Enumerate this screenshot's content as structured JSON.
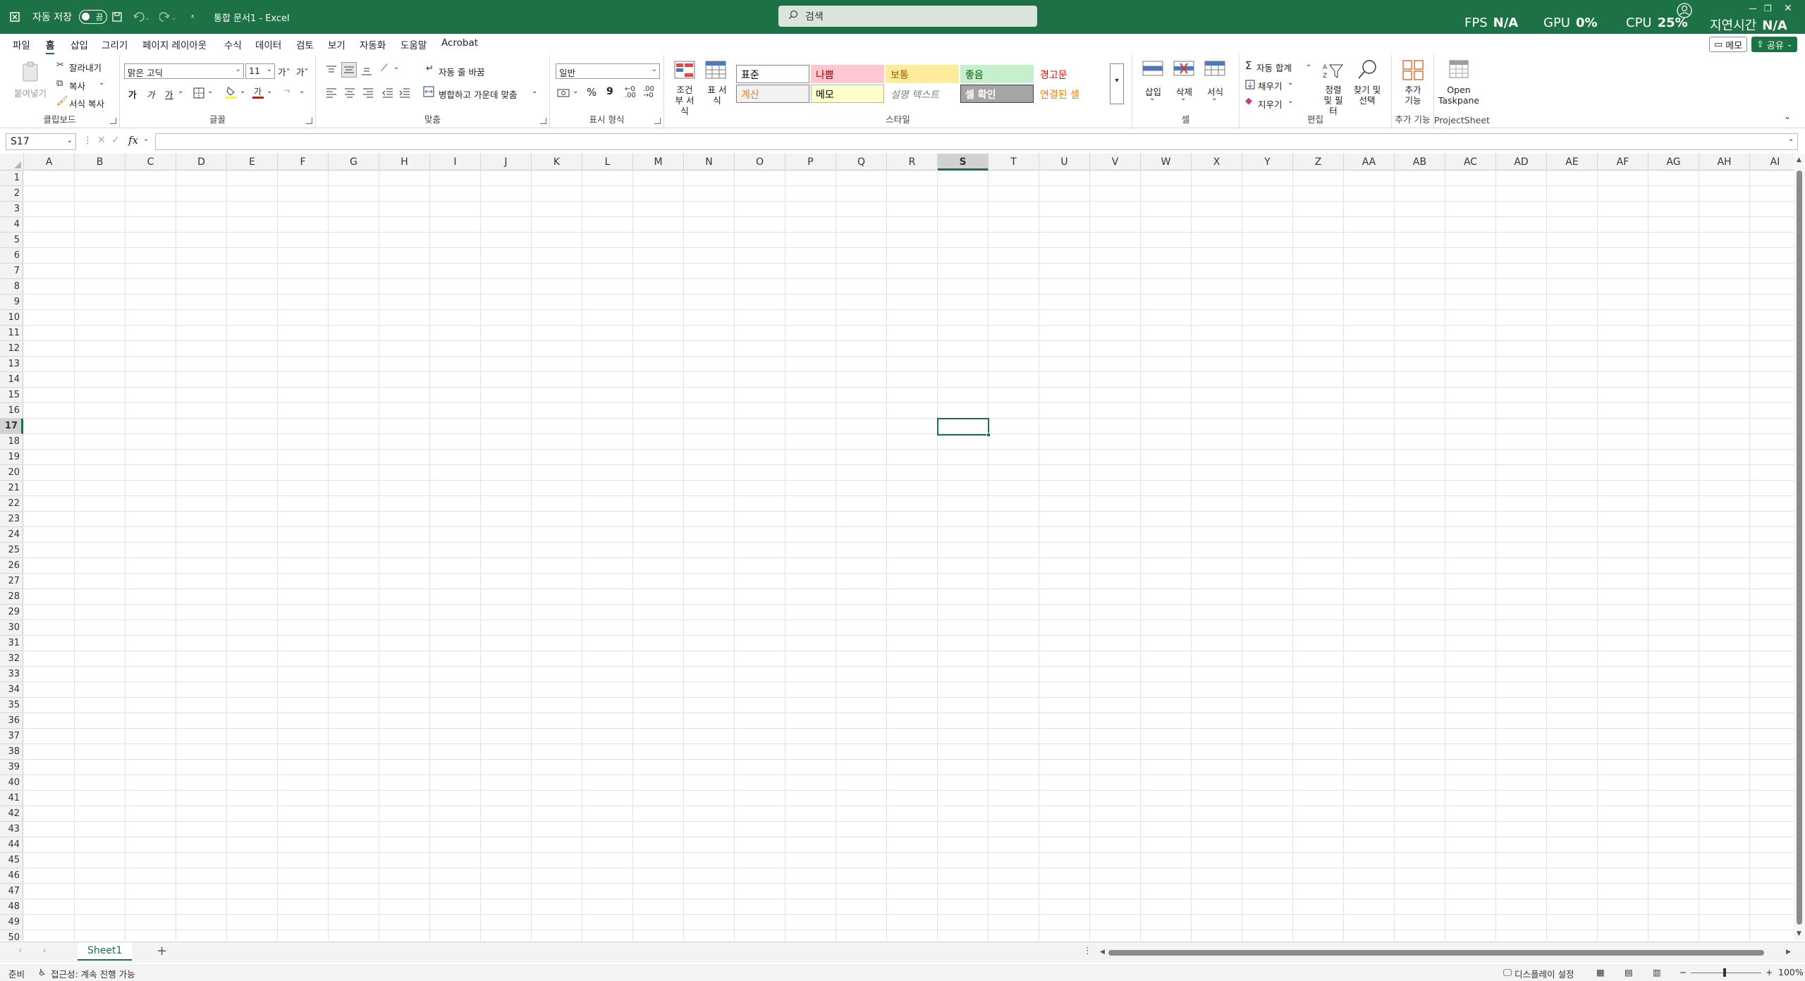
{
  "titlebar": {
    "autosave_label": "자동 저장",
    "autosave_state": "끔",
    "doc_title": "통합 문서1  -  Excel",
    "search_placeholder": "검색",
    "fps_label": "FPS",
    "fps_value": "N/A",
    "gpu_label": "GPU",
    "gpu_value": "0%",
    "cpu_label": "CPU",
    "cpu_value": "25%",
    "latency_label": "지연시간",
    "latency_value": "N/A"
  },
  "menu": {
    "tabs": [
      "파일",
      "홈",
      "삽입",
      "그리기",
      "페이지 레이아웃",
      "수식",
      "데이터",
      "검토",
      "보기",
      "자동화",
      "도움말",
      "Acrobat"
    ],
    "active_tab": "홈",
    "memo_button": "메모",
    "share_button": "공유"
  },
  "ribbon": {
    "clipboard": {
      "paste": "붙여넣기",
      "cut": "잘라내기",
      "copy": "복사",
      "format_painter": "서식 복사",
      "label": "클립보드"
    },
    "font": {
      "name": "맑은 고딕",
      "size": "11",
      "grow": "가ˆ",
      "shrink": "가ˇ",
      "bold": "가",
      "italic": "가",
      "underline": "가",
      "label": "글꼴"
    },
    "alignment": {
      "wrap": "자동 줄 바꿈",
      "merge": "병합하고 가운데 맞춤",
      "label": "맞춤"
    },
    "number": {
      "format": "일반",
      "percent": "%",
      "comma": "9",
      "label": "표시 형식"
    },
    "styles": {
      "conditional": "조건부 서식",
      "table": "표 서식",
      "cells": [
        {
          "text": "표준",
          "bg": "#ffffff",
          "fg": "#000000",
          "border": "#888888"
        },
        {
          "text": "나쁨",
          "bg": "#ffc7ce",
          "fg": "#9c0006",
          "border": "#ffc7ce"
        },
        {
          "text": "보통",
          "bg": "#ffeb9c",
          "fg": "#9c5700",
          "border": "#ffeb9c"
        },
        {
          "text": "좋음",
          "bg": "#c6efce",
          "fg": "#006100",
          "border": "#c6efce"
        },
        {
          "text": "경고문",
          "bg": "#ffffff",
          "fg": "#ff0000",
          "border": "#ffffff"
        },
        {
          "text": "계산",
          "bg": "#f2f2f2",
          "fg": "#fa7d00",
          "border": "#7f7f7f"
        },
        {
          "text": "메모",
          "bg": "#ffffcc",
          "fg": "#000000",
          "border": "#b2b2b2"
        },
        {
          "text": "설명 텍스트",
          "bg": "#ffffff",
          "fg": "#7f7f7f",
          "border": "#ffffff"
        },
        {
          "text": "셀 확인",
          "bg": "#a5a5a5",
          "fg": "#ffffff",
          "border": "#3f3f3f"
        },
        {
          "text": "연결된 셀",
          "bg": "#ffffff",
          "fg": "#fa7d00",
          "border": "#ffffff"
        }
      ],
      "label": "스타일"
    },
    "cells": {
      "insert": "삽입",
      "delete": "삭제",
      "format": "서식",
      "label": "셀"
    },
    "editing": {
      "autosum": "자동 합계",
      "fill": "채우기",
      "clear": "지우기",
      "sort": "정렬 및 필터",
      "find": "찾기 및 선택",
      "label": "편집"
    },
    "addins": {
      "addins": "추가 기능",
      "label": "추가 기능"
    },
    "projectsheet": {
      "open": "Open Taskpane",
      "label": "ProjectSheet"
    }
  },
  "formula": {
    "namebox": "S17",
    "fx": "fx",
    "value": ""
  },
  "sheet": {
    "columns": [
      "A",
      "B",
      "C",
      "D",
      "E",
      "F",
      "G",
      "H",
      "I",
      "J",
      "K",
      "L",
      "M",
      "N",
      "O",
      "P",
      "Q",
      "R",
      "S",
      "T",
      "U",
      "V",
      "W",
      "X",
      "Y",
      "Z",
      "AA",
      "AB",
      "AC",
      "AD",
      "AE",
      "AF",
      "AG",
      "AH",
      "AI"
    ],
    "rows": [
      "1",
      "2",
      "3",
      "4",
      "5",
      "6",
      "7",
      "8",
      "9",
      "10",
      "11",
      "12",
      "13",
      "14",
      "15",
      "16",
      "17",
      "18",
      "19",
      "20",
      "21",
      "22",
      "23",
      "24",
      "25",
      "26",
      "27",
      "28",
      "29",
      "30",
      "31",
      "32",
      "33",
      "34",
      "35",
      "36",
      "37",
      "38",
      "39",
      "40",
      "41",
      "42",
      "43",
      "44",
      "45",
      "46",
      "47",
      "48",
      "49",
      "50"
    ],
    "selected_col": "S",
    "selected_row": "17",
    "tab": "Sheet1"
  },
  "status": {
    "ready": "준비",
    "accessibility": "접근성: 계속 진행 가능",
    "display": "디스플레이 설정",
    "zoom": "100%"
  },
  "colors": {
    "accent": "#1d7245"
  }
}
